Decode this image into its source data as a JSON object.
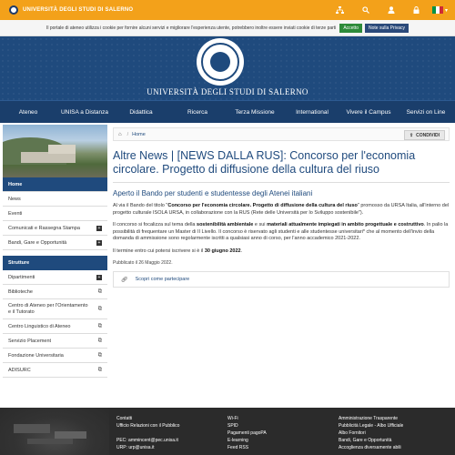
{
  "topbar": {
    "brand": "UNIVERSITÀ DEGLI STUDI DI SALERNO",
    "icons": [
      "sitemap-icon",
      "search-icon",
      "user-icon",
      "lock-icon",
      "flag-it-icon"
    ],
    "flag_colors": [
      "#009246",
      "#ffffff",
      "#ce2b37"
    ],
    "accent": "#f3a11a"
  },
  "cookie": {
    "text": "Il portale di ateneo utilizza i cookie per fornire alcuni servizi e migliorare l'esperienza utente, potrebbero inoltre essere inviati cookie di terze parti",
    "accept": "Accetto",
    "privacy": "Note sulla Privacy"
  },
  "header": {
    "title": "UNIVERSITÀ DEGLI STUDI DI SALERNO",
    "bg": "#1f4a7d"
  },
  "nav": [
    "Ateneo",
    "UNISA a Distanza",
    "Didattica",
    "Ricerca",
    "Terza Missione",
    "International",
    "Vivere il Campus",
    "Servizi on Line"
  ],
  "sidebar": {
    "items": [
      {
        "label": "Home"
      },
      {
        "label": "News"
      },
      {
        "label": "Eventi"
      },
      {
        "label": "Comunicati e Rassegna Stampa"
      },
      {
        "label": "Bandi, Gare e Opportunità"
      }
    ],
    "structures_header": "Strutture",
    "structures": [
      {
        "label": "Dipartimenti"
      },
      {
        "label": "Biblioteche"
      },
      {
        "label": "Centro di Ateneo per l'Orientamento e il Tutorato"
      },
      {
        "label": "Centro Linguistico di Ateneo"
      },
      {
        "label": "Servizio Placement"
      },
      {
        "label": "Fondazione Universitaria"
      },
      {
        "label": "ADISURC"
      }
    ]
  },
  "breadcrumb": {
    "home": "Home",
    "share": "CONDIVIDI"
  },
  "article": {
    "title": "Altre News | [NEWS DALLA RUS]: Concorso per l'economia circolare. Progetto di diffusione della cultura del riuso",
    "subtitle": "Aperto il Bando per studenti e studentesse degli Atenei italiani",
    "p1_a": "Al via il Bando del titolo \"",
    "p1_b": "Concorso per l'economia circolare. Progetto di diffusione della cultura del riuso",
    "p1_c": "\" promosso da URSA Italia, all'interno del progetto culturale ISOLA URSA, in collaborazione con la RUS (Rete delle Università per lo Sviluppo sostenibile\").",
    "p2_a": "Il concorso si focalizza sul tema della ",
    "p2_b": "sostenibilità ambientale",
    "p2_c": " e sui ",
    "p2_d": "materiali attualmente impiegati in ambito progettuale e costruttivo",
    "p2_e": ". In palio la possibilità di frequentare un Master di II Livello. Il concorso è riservato agli studenti e alle studentesse universitari* che al momento dell'invio della domanda di ammissione sono regolarmente iscritti a qualsiasi anno di corso, per l'anno accademico 2021-2022.",
    "p3_a": "Il termine entro cui potersi iscrivere si è il ",
    "p3_b": "30 giugno 2022",
    "p3_c": ".",
    "published": "Pubblicato il 26 Maggio 2022.",
    "scopri": "Scopri come partecipare"
  },
  "footer": {
    "col1": [
      "Contatti",
      "Ufficio Relazioni con il Pubblico",
      "PEC: ammincent@pec.unisa.it",
      "URP: urp@unisa.it"
    ],
    "col2": [
      "Wi-Fi",
      "SPID",
      "Pagamenti pagoPA",
      "E-learning",
      "Feed RSS"
    ],
    "col3": [
      "Amministrazione Trasparente",
      "Pubblicità Legale - Albo Ufficiale",
      "Albo Fornitori",
      "Bandi, Gare e Opportunità",
      "Accoglienza diversamente abili"
    ]
  }
}
